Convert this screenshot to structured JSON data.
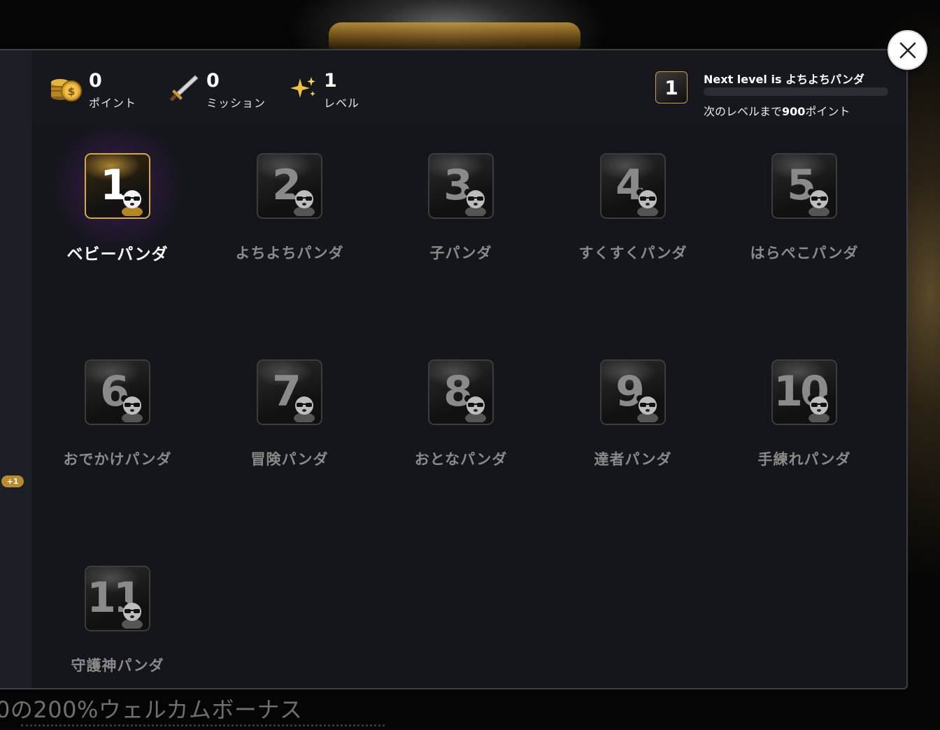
{
  "background": {
    "promo_text": "0の200%ウェルカムボーナス"
  },
  "stats": {
    "points": {
      "value": "0",
      "label": "ポイント",
      "icon": "coins-icon"
    },
    "missions": {
      "value": "0",
      "label": "ミッション",
      "icon": "sword-icon"
    },
    "level": {
      "value": "1",
      "label": "レベル",
      "icon": "sparkles-icon"
    }
  },
  "next_level": {
    "badge_number": "1",
    "title": "Next level is よちよちパンダ",
    "progress_fraction": 0.0,
    "sub_prefix": "次のレベルまで",
    "sub_points": "900",
    "sub_suffix": "ポイント"
  },
  "side": {
    "badge": "+1"
  },
  "levels": [
    {
      "number": "1",
      "name": "ベビーパンダ",
      "active": true
    },
    {
      "number": "2",
      "name": "よちよちパンダ",
      "active": false
    },
    {
      "number": "3",
      "name": "子パンダ",
      "active": false
    },
    {
      "number": "4",
      "name": "すくすくパンダ",
      "active": false
    },
    {
      "number": "5",
      "name": "はらぺこパンダ",
      "active": false
    },
    {
      "number": "6",
      "name": "おでかけパンダ",
      "active": false
    },
    {
      "number": "7",
      "name": "冒険パンダ",
      "active": false
    },
    {
      "number": "8",
      "name": "おとなパンダ",
      "active": false
    },
    {
      "number": "9",
      "name": "達者パンダ",
      "active": false
    },
    {
      "number": "10",
      "name": "手練れパンダ",
      "active": false
    },
    {
      "number": "11",
      "name": "守護神パンダ",
      "active": false
    }
  ],
  "colors": {
    "accent_purple": "#6b2184",
    "gold": "#d3a94d",
    "inactive_text": "#8a8a8a"
  }
}
